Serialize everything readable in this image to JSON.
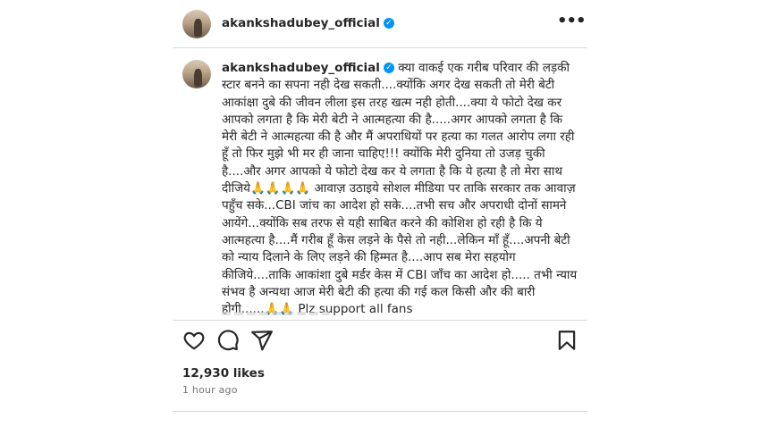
{
  "post": {
    "username": "akankshadubey_official",
    "more_icon": "more-horizontal-icon",
    "caption_text": "क्या वाकई एक गरीब परिवार की लड़की स्टार बनने का सपना नही देख सकती....क्योंकि अगर देख सकती तो मेरी बेटी आकांक्षा दुबे की जीवन लीला इस तरह खत्म नही होती....क्या ये फोटो देख कर आपको लगता है कि मेरी बेटी ने आत्महत्या की है.....अगर आपको लगता है कि मेरी बेटी ने आत्महत्या की है और मैं अपराधियों पर हत्या का गलत आरोप लगा रही हूँ तो फिर मुझे भी मर ही जाना चाहिए!!! क्योंकि मेरी दुनिया तो उजड़ चुकी है....और अगर आपको ये फोटो देख कर ये लगता है कि ये हत्या है तो मेरा साथ दीजिये🙏🙏🙏🙏 आवाज़ उठाइये सोशल मीडिया पर ताकि सरकार तक आवाज़ पहुँच सके...CBI जांच का आदेश हो सके....तभी सच और अपराधी दोनों सामने आयेंगे...क्योंकि सब तरफ से यही साबित करने की कोशिश हो रही है कि ये आत्महत्या है....मैं गरीब हूँ केस लड़ने के पैसे तो नही...लेकिन माँ हूँ....अपनी बेटी को न्याय दिलाने के लिए लड़ने की हिम्मत है....आप सब मेरा सहयोग कीजिये....ताकि आकांशा दुबे मर्डर केस में CBI जाँच का आदेश हो..... तभी न्याय संभव है अन्यथा आज मेरी बेटी की हत्या की गई कल किसी और की बारी होगी......🙏🙏 Plz support all fans",
    "likes": "12,930 likes",
    "time": "1 hour ago",
    "verified_badge": "✓",
    "colors": {
      "verified": "#0095f6",
      "text": "#262626",
      "muted": "#737373",
      "divider": "#dbdbdb"
    }
  },
  "actions": {
    "like_icon": "heart-icon",
    "comment_icon": "comment-icon",
    "share_icon": "share-icon",
    "save_icon": "bookmark-icon"
  }
}
